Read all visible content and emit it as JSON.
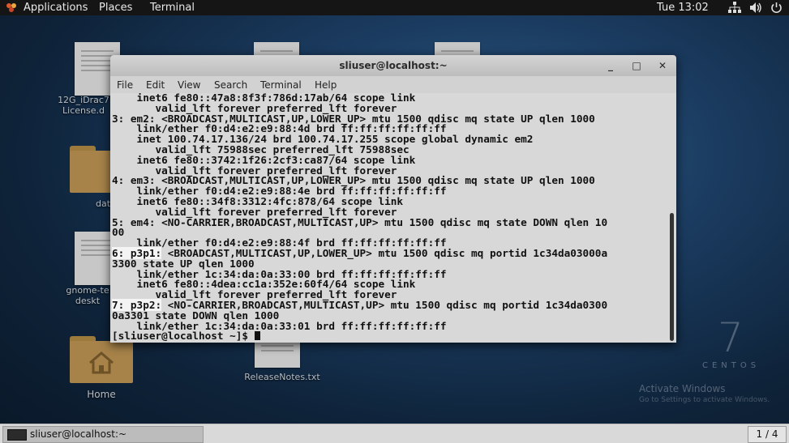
{
  "topbar": {
    "applications": "Applications",
    "places": "Places",
    "terminal": "Terminal",
    "clock": "Tue 13:02",
    "icons": [
      "network-icon",
      "volume-icon",
      "power-icon"
    ]
  },
  "desktop": {
    "icons": [
      {
        "label": "12G_iDrac7\nLicense.d"
      },
      {
        "label": "dat"
      },
      {
        "label": "gnome-te\ndeskt"
      },
      {
        "label": "Home"
      },
      {
        "label": "ReleaseNotes.txt"
      }
    ],
    "watermark_number": "7",
    "watermark_word": "CENTOS",
    "activate_title": "Activate Windows",
    "activate_sub": "Go to Settings to activate Windows."
  },
  "window": {
    "title": "sliuser@localhost:~",
    "minimize": "_",
    "maximize": "□",
    "close": "✕",
    "menu": [
      "File",
      "Edit",
      "View",
      "Search",
      "Terminal",
      "Help"
    ]
  },
  "terminal": {
    "lines": [
      "    inet6 fe80::47a8:8f3f:786d:17ab/64 scope link",
      "       valid_lft forever preferred_lft forever",
      "3: em2: <BROADCAST,MULTICAST,UP,LOWER_UP> mtu 1500 qdisc mq state UP qlen 1000",
      "    link/ether f0:d4:e2:e9:88:4d brd ff:ff:ff:ff:ff:ff",
      "    inet 100.74.17.136/24 brd 100.74.17.255 scope global dynamic em2",
      "       valid_lft 75988sec preferred_lft 75988sec",
      "    inet6 fe80::3742:1f26:2cf3:ca87/64 scope link",
      "       valid_lft forever preferred_lft forever",
      "4: em3: <BROADCAST,MULTICAST,UP,LOWER_UP> mtu 1500 qdisc mq state UP qlen 1000",
      "    link/ether f0:d4:e2:e9:88:4e brd ff:ff:ff:ff:ff:ff",
      "    inet6 fe80::34f8:3312:4fc:878/64 scope link",
      "       valid_lft forever preferred_lft forever",
      "5: em4: <NO-CARRIER,BROADCAST,MULTICAST,UP> mtu 1500 qdisc mq state DOWN qlen 10",
      "00",
      "    link/ether f0:d4:e2:e9:88:4f brd ff:ff:ff:ff:ff:ff",
      "6: p3p1: <BROADCAST,MULTICAST,UP,LOWER_UP> mtu 1500 qdisc mq portid 1c34da03000a",
      "3300 state UP qlen 1000",
      "    link/ether 1c:34:da:0a:33:00 brd ff:ff:ff:ff:ff:ff",
      "    inet6 fe80::4dea:cc1a:352e:60f4/64 scope link",
      "       valid_lft forever preferred_lft forever",
      "7: p3p2: <NO-CARRIER,BROADCAST,MULTICAST,UP> mtu 1500 qdisc mq portid 1c34da0300",
      "0a3301 state DOWN qlen 1000",
      "    link/ether 1c:34:da:0a:33:01 brd ff:ff:ff:ff:ff:ff",
      "[sliuser@localhost ~]$ "
    ]
  },
  "taskbar": {
    "task_label": "sliuser@localhost:~",
    "workspace": "1 / 4"
  }
}
